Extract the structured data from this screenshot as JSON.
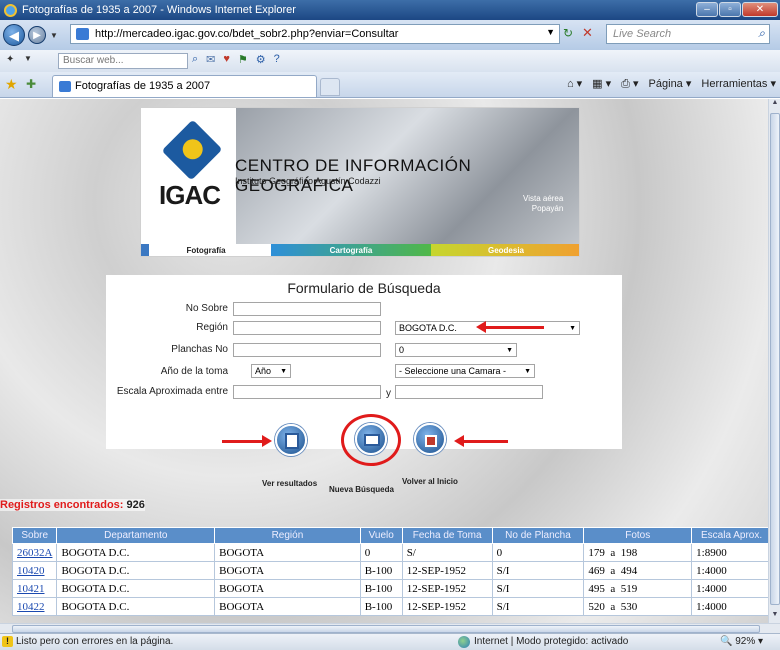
{
  "window": {
    "title": "Fotografías de 1935 a 2007 - Windows Internet Explorer"
  },
  "address": {
    "url": "http://mercadeo.igac.gov.co/bdet_sobr2.php?enviar=Consultar",
    "search_placeholder": "Live Search"
  },
  "toolbar": {
    "search_placeholder": "Buscar web..."
  },
  "tab": {
    "label": "Fotografías de 1935 a 2007",
    "tools": [
      "Página ▾",
      "Herramientas ▾"
    ]
  },
  "banner": {
    "logo_text": "IGAC",
    "title": "CENTRO DE INFORMACIÓN GEOGRÁFICA",
    "subtitle": "Instituto Geográfico Agustín Codazzi",
    "photo_caption_1": "Vista aérea",
    "photo_caption_2": "Popayán",
    "nav": [
      "Fotografía",
      "Cartografía",
      "Geodesia"
    ]
  },
  "form": {
    "title": "Formulario de Búsqueda",
    "labels": {
      "sobre": "No Sobre",
      "region": "Región",
      "planchas": "Planchas No",
      "anio": "Año de la toma",
      "escala": "Escala Aproximada entre",
      "y": "y"
    },
    "region_select": "BOGOTA D.C.",
    "planchas_select": "0",
    "anio_select": "Año",
    "camara_select": "- Seleccione una Camara -",
    "buttons": {
      "ver": "Ver resultados",
      "nueva": "Nueva Búsqueda",
      "volver": "Volver al Inicio"
    }
  },
  "results": {
    "label": "Registros encontrados:",
    "count": "926",
    "headers": [
      "Sobre",
      "Departamento",
      "Región",
      "Vuelo",
      "Fecha de Toma",
      "No de Plancha",
      "Fotos",
      "Escala Aprox."
    ],
    "rows": [
      {
        "sobre": "26032A",
        "depto": "BOGOTA D.C.",
        "region": "BOGOTA",
        "vuelo": "0",
        "fecha": "S/",
        "plancha": "0",
        "f1": "179",
        "a": "a",
        "f2": "198",
        "escala": "1:8900"
      },
      {
        "sobre": "10420",
        "depto": "BOGOTA D.C.",
        "region": "BOGOTA",
        "vuelo": "B-100",
        "fecha": "12-SEP-1952",
        "plancha": "S/I",
        "f1": "469",
        "a": "a",
        "f2": "494",
        "escala": "1:4000"
      },
      {
        "sobre": "10421",
        "depto": "BOGOTA D.C.",
        "region": "BOGOTA",
        "vuelo": "B-100",
        "fecha": "12-SEP-1952",
        "plancha": "S/I",
        "f1": "495",
        "a": "a",
        "f2": "519",
        "escala": "1:4000"
      },
      {
        "sobre": "10422",
        "depto": "BOGOTA D.C.",
        "region": "BOGOTA",
        "vuelo": "B-100",
        "fecha": "12-SEP-1952",
        "plancha": "S/I",
        "f1": "520",
        "a": "a",
        "f2": "530",
        "escala": "1:4000"
      }
    ]
  },
  "status": {
    "text": "Listo pero con errores en la página.",
    "zone": "Internet | Modo protegido: activado",
    "zoom": "92%"
  }
}
